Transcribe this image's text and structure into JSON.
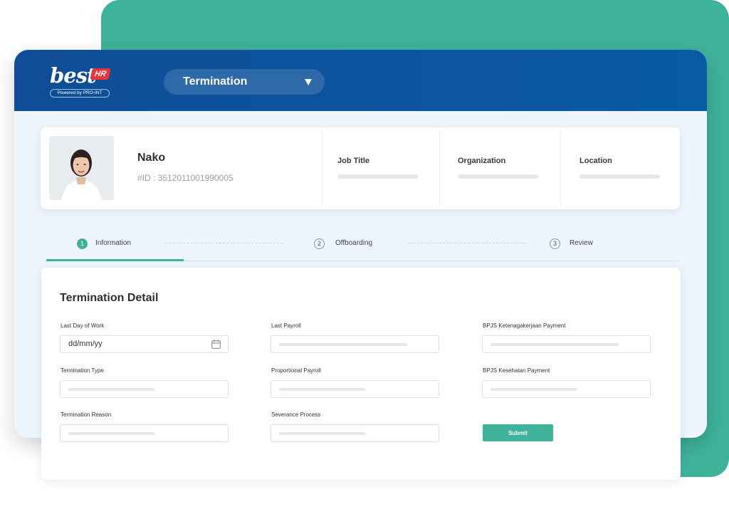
{
  "brand": {
    "logo_main": "best",
    "logo_badge": "HR",
    "powered_by": "Powered by PRO-INT"
  },
  "header": {
    "module_select": {
      "value": "Termination",
      "icon": "caret-down-icon"
    }
  },
  "employee": {
    "name": "Nako",
    "id": "#ID : 3512011001990005",
    "photo": "employee-photo",
    "fields": [
      {
        "label": "Job Title"
      },
      {
        "label": "Organization"
      },
      {
        "label": "Location"
      }
    ]
  },
  "stepper": {
    "active_step": 1,
    "steps": [
      {
        "number": "1",
        "label": "Information"
      },
      {
        "number": "2",
        "label": "Offboarding"
      },
      {
        "number": "3",
        "label": "Review"
      }
    ]
  },
  "form": {
    "title": "Termination Detail",
    "fields": {
      "last_day_of_work": {
        "label": "Last Day of Work",
        "placeholder": "dd/mm/yy",
        "icon": "calendar-icon"
      },
      "last_payroll": {
        "label": "Last Payroll"
      },
      "bpjs_ketenagakerjaan": {
        "label": "BPJS Ketenagakerjaan Payment"
      },
      "termination_type": {
        "label": "Termination Type"
      },
      "proportional_payroll": {
        "label": "Proportional Payroll"
      },
      "bpjs_kesehatan": {
        "label": "BPJS Kesehatan Payment"
      },
      "termination_reason": {
        "label": "Termination Reason"
      },
      "severance_process": {
        "label": "Severance Process"
      }
    },
    "submit_label": "Submit"
  },
  "colors": {
    "accent_green": "#3fb39a",
    "header_blue": "#0f4d96",
    "select_blue": "#2e6aa9",
    "panel_background": "#eef5fd"
  }
}
